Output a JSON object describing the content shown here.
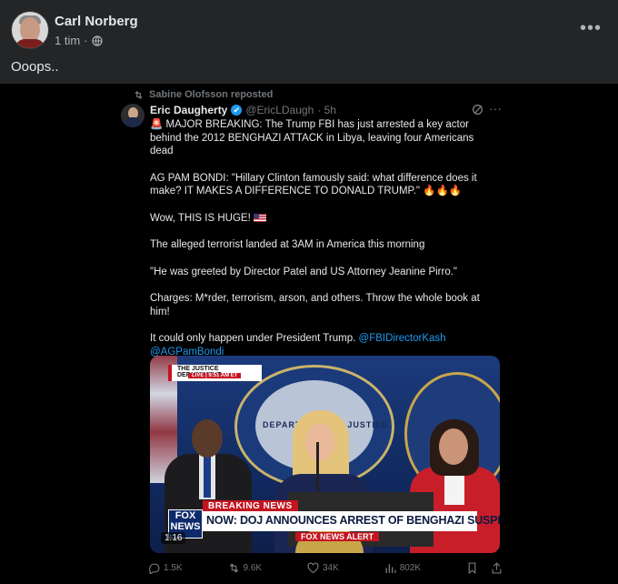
{
  "post": {
    "author": "Carl Norberg",
    "time": "1 tim",
    "separator": "·",
    "privacy_icon": "globe-icon",
    "text": "Ooops..",
    "more_label": "•••"
  },
  "tweet": {
    "repost_label": "Sabine Olofsson reposted",
    "author_name": "Eric Daugherty",
    "handle": "@EricLDaugh",
    "time": "· 5h",
    "verified_icon": "✔",
    "lines": [
      "MAJOR BREAKING: The Trump FBI has just arrested a key actor behind the 2012 BENGHAZI ATTACK in Libya, leaving four Americans dead",
      "AG PAM BONDI: \"Hillary Clinton famously said: what difference does it make? IT MAKES A DIFFERENCE TO DONALD TRUMP.\"",
      "Wow, THIS IS HUGE!",
      "The alleged terrorist landed at 3AM in America this morning",
      "\"He was greeted by Director Patel and US Attorney Jeanine Pirro.\"",
      "Charges: M*rder, terrorism, arson, and others. Throw the whole book at him!",
      "It could only happen under President Trump."
    ],
    "mention1": "@FBIDirectorKash",
    "mention2": "@AGPamBondi",
    "siren": "🚨",
    "flames": "🔥🔥🔥"
  },
  "video": {
    "tag_title": "THE JUSTICE DEPARTMENT",
    "tag_live": "LIVE | 9:51 AM ET",
    "seal_text": "DEPARTMENT OF JUSTICE",
    "breaking": "BREAKING NEWS",
    "headline": "NOW: DOJ ANNOUNCES ARREST OF BENGHAZI SUSPECT",
    "logo": "FOX NEWS",
    "alert": "FOX NEWS ALERT",
    "duration": "1:16"
  },
  "actions": {
    "replies": "1.5K",
    "reposts": "9.6K",
    "likes": "34K",
    "views": "802K"
  }
}
